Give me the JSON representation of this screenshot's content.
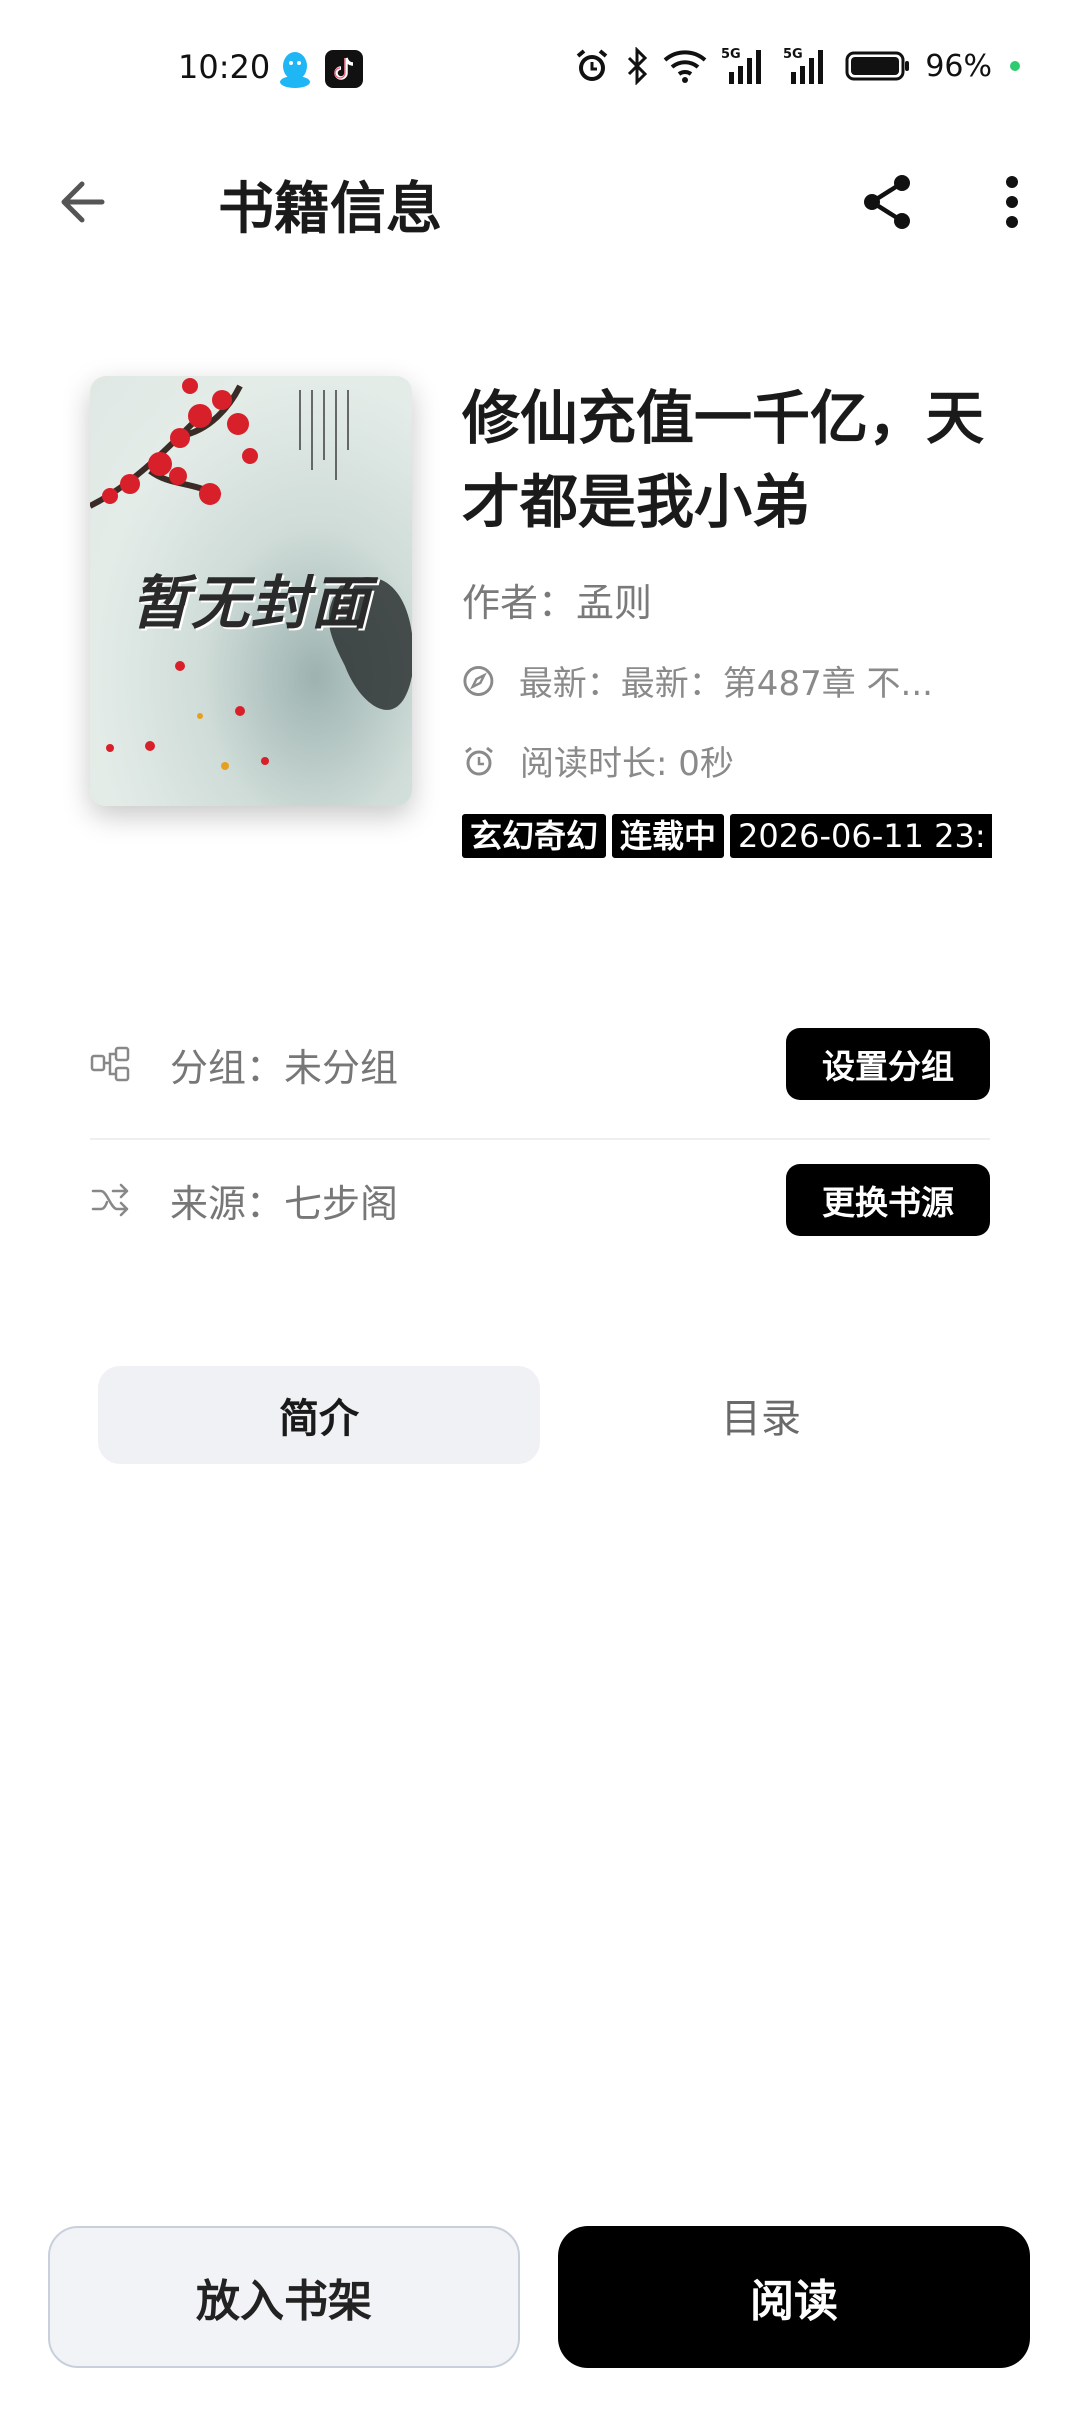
{
  "status_bar": {
    "time": "10:20",
    "battery": "96%",
    "left_icons": [
      "qq-icon",
      "tiktok-icon"
    ],
    "right_icons": [
      "alarm-icon",
      "bluetooth-icon",
      "wifi-icon",
      "signal-5g-icon",
      "signal-5g-icon",
      "battery-icon"
    ],
    "signal_label": "5G"
  },
  "app_bar": {
    "title": "书籍信息",
    "back_icon": "arrow-left-icon",
    "share_icon": "share-icon",
    "more_icon": "more-vertical-icon"
  },
  "book": {
    "cover_text": "暂无封面",
    "title": "修仙充值一千亿，天才都是我小弟",
    "author": "作者：孟则",
    "latest": "最新：最新：第487章 不...",
    "read_time": "阅读时长: 0秒",
    "tags": [
      "玄幻奇幻",
      "连载中"
    ],
    "update_date": "2026-06-11 23:"
  },
  "group": {
    "label": "分组：未分组",
    "button": "设置分组"
  },
  "source": {
    "label": "来源：七步阁",
    "button": "更换书源"
  },
  "tabs": [
    {
      "label": "简介",
      "selected": true
    },
    {
      "label": "目录",
      "selected": false
    }
  ],
  "actions": {
    "shelf": "放入书架",
    "read": "阅读"
  },
  "colors": {
    "accent": "#000000",
    "tab_selected_bg": "#f0f1f4",
    "secondary_button_bg": "#f1f3f6",
    "battery_dot": "#2ecc71"
  }
}
